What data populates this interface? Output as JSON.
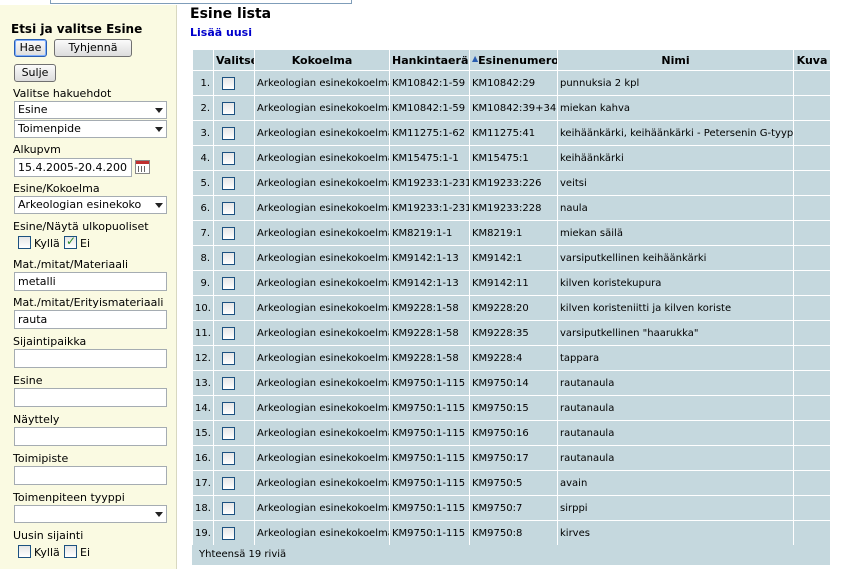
{
  "sidebar": {
    "title": "Etsi ja valitse Esine",
    "search_button": "Hae",
    "clear_button": "Tyhjennä",
    "close_button": "Sulje",
    "criteria_label": "Valitse hakuehdot",
    "select_object": "Esine",
    "select_action": "Toimenpide",
    "start_date_label": "Alkupvm",
    "start_date_value": "15.4.2005-20.4.200",
    "collection_label": "Esine/Kokoelma",
    "collection_value": "Arkeologian esinekoko",
    "show_external_label": "Esine/Näytä ulkopuoliset",
    "yes_label": "Kyllä",
    "no_label": "Ei",
    "material_label": "Mat./mitat/Materiaali",
    "material_value": "metalli",
    "special_material_label": "Mat./mitat/Erityismateriaali",
    "special_material_value": "rauta",
    "location_label": "Sijaintipaikka",
    "object_label": "Esine",
    "exhibition_label": "Näyttely",
    "unit_label": "Toimipiste",
    "action_type_label": "Toimenpiteen tyyppi",
    "latest_location_label": "Uusin sijainti",
    "latest_yes_label": "Kyllä",
    "latest_no_label": "Ei"
  },
  "main": {
    "title": "Esine lista",
    "add_new": "Lisää uusi",
    "columns": [
      "Valitse",
      "Kokoelma",
      "Hankintaerä",
      "Esinenumero",
      "Nimi",
      "Kuva"
    ],
    "rows": [
      {
        "n": "1.",
        "collection": "Arkeologian esinekokoelma",
        "batch": "KM10842:1-59",
        "number": "KM10842:29",
        "name": "punnuksia 2 kpl"
      },
      {
        "n": "2.",
        "collection": "Arkeologian esinekokoelma",
        "batch": "KM10842:1-59",
        "number": "KM10842:39+34",
        "name": "miekan kahva"
      },
      {
        "n": "3.",
        "collection": "Arkeologian esinekokoelma",
        "batch": "KM11275:1-62",
        "number": "KM11275:41",
        "name": "keihäänkärki, keihäänkärki - Petersenin G-tyyppi"
      },
      {
        "n": "4.",
        "collection": "Arkeologian esinekokoelma",
        "batch": "KM15475:1-1",
        "number": "KM15475:1",
        "name": "keihäänkärki"
      },
      {
        "n": "5.",
        "collection": "Arkeologian esinekokoelma",
        "batch": "KM19233:1-231",
        "number": "KM19233:226",
        "name": "veitsi"
      },
      {
        "n": "6.",
        "collection": "Arkeologian esinekokoelma",
        "batch": "KM19233:1-231",
        "number": "KM19233:228",
        "name": "naula"
      },
      {
        "n": "7.",
        "collection": "Arkeologian esinekokoelma",
        "batch": "KM8219:1-1",
        "number": "KM8219:1",
        "name": "miekan säilä"
      },
      {
        "n": "8.",
        "collection": "Arkeologian esinekokoelma",
        "batch": "KM9142:1-13",
        "number": "KM9142:1",
        "name": "varsiputkellinen keihäänkärki"
      },
      {
        "n": "9.",
        "collection": "Arkeologian esinekokoelma",
        "batch": "KM9142:1-13",
        "number": "KM9142:11",
        "name": "kilven koristekupura"
      },
      {
        "n": "10.",
        "collection": "Arkeologian esinekokoelma",
        "batch": "KM9228:1-58",
        "number": "KM9228:20",
        "name": "kilven koristeniitti ja kilven koriste"
      },
      {
        "n": "11.",
        "collection": "Arkeologian esinekokoelma",
        "batch": "KM9228:1-58",
        "number": "KM9228:35",
        "name": "varsiputkellinen \"haarukka\""
      },
      {
        "n": "12.",
        "collection": "Arkeologian esinekokoelma",
        "batch": "KM9228:1-58",
        "number": "KM9228:4",
        "name": "tappara"
      },
      {
        "n": "13.",
        "collection": "Arkeologian esinekokoelma",
        "batch": "KM9750:1-115",
        "number": "KM9750:14",
        "name": "rautanaula"
      },
      {
        "n": "14.",
        "collection": "Arkeologian esinekokoelma",
        "batch": "KM9750:1-115",
        "number": "KM9750:15",
        "name": "rautanaula"
      },
      {
        "n": "15.",
        "collection": "Arkeologian esinekokoelma",
        "batch": "KM9750:1-115",
        "number": "KM9750:16",
        "name": "rautanaula"
      },
      {
        "n": "16.",
        "collection": "Arkeologian esinekokoelma",
        "batch": "KM9750:1-115",
        "number": "KM9750:17",
        "name": "rautanaula"
      },
      {
        "n": "17.",
        "collection": "Arkeologian esinekokoelma",
        "batch": "KM9750:1-115",
        "number": "KM9750:5",
        "name": "avain"
      },
      {
        "n": "18.",
        "collection": "Arkeologian esinekokoelma",
        "batch": "KM9750:1-115",
        "number": "KM9750:7",
        "name": "sirppi"
      },
      {
        "n": "19.",
        "collection": "Arkeologian esinekokoelma",
        "batch": "KM9750:1-115",
        "number": "KM9750:8",
        "name": "kirves"
      }
    ],
    "footer": "Yhteensä 19 riviä"
  },
  "icons": {
    "calendar": "calendar-icon",
    "sort": "sort-ascending-icon",
    "dropdown": "chevron-down-icon"
  }
}
